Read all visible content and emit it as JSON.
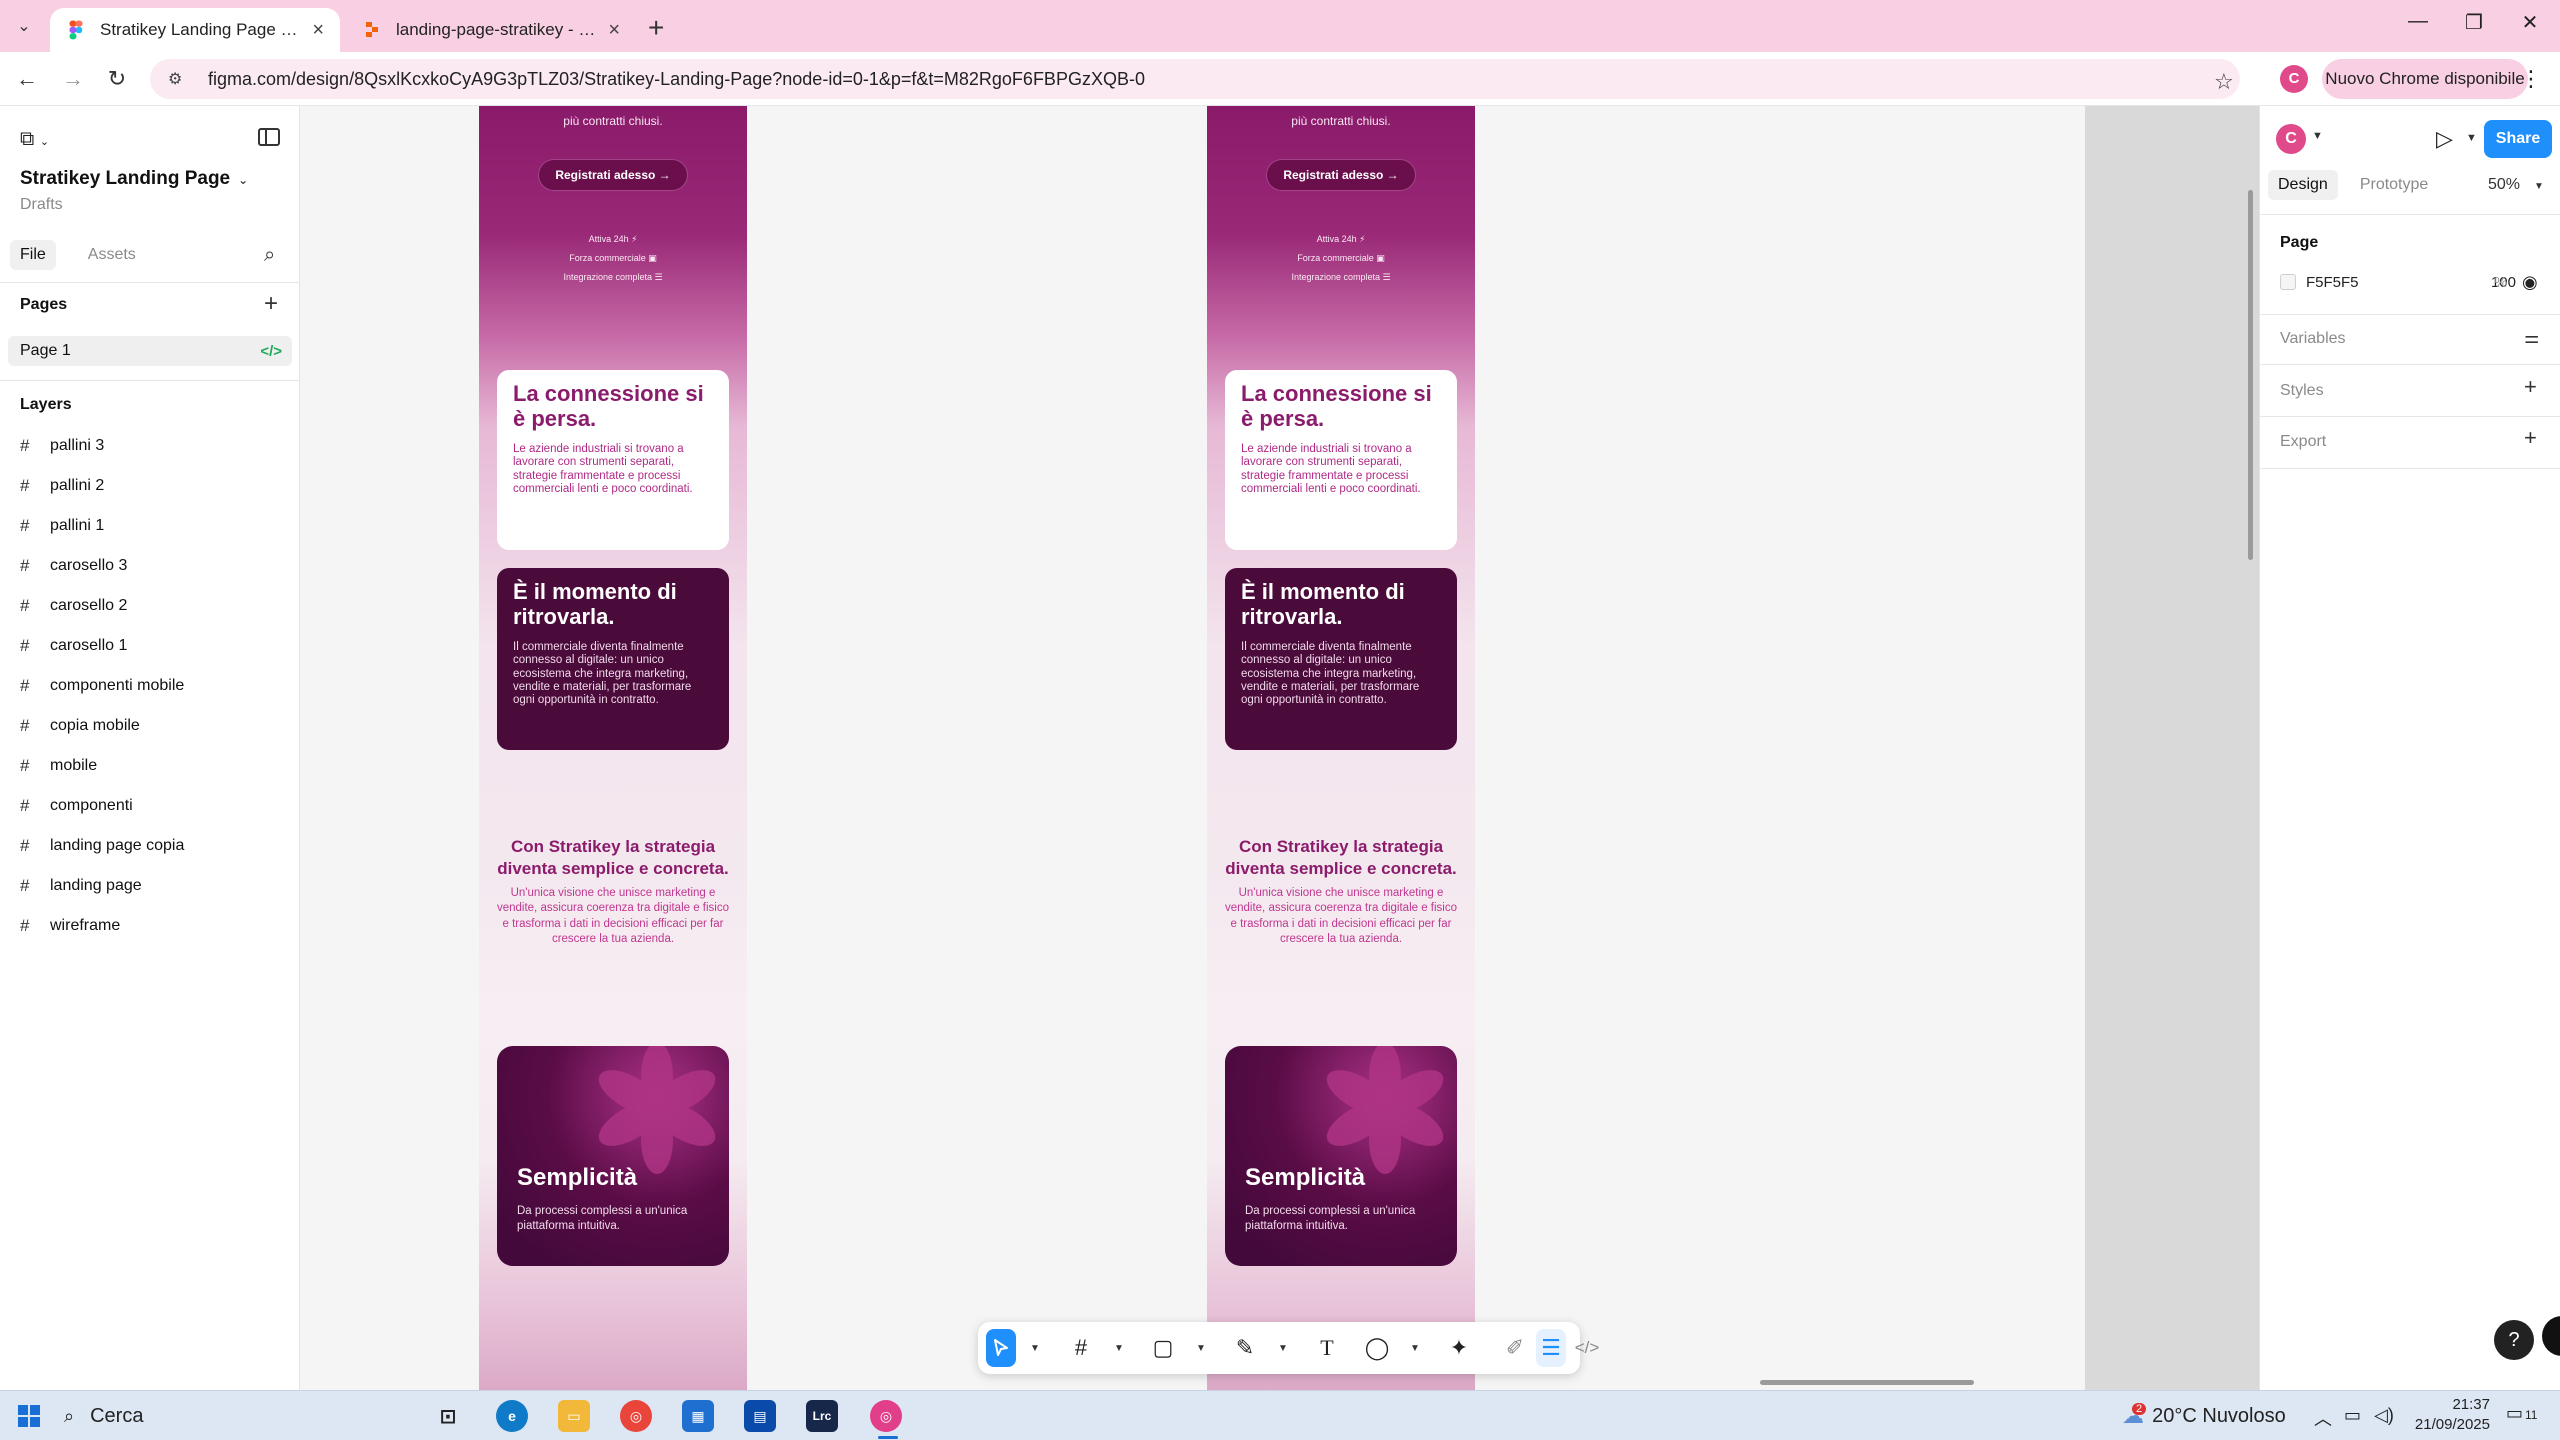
{
  "browser": {
    "tabs": [
      {
        "title": "Stratikey Landing Page – Figma",
        "active": true
      },
      {
        "title": "landing-page-stratikey - Replit",
        "active": false
      }
    ],
    "url": "figma.com/design/8QsxlKcxkoCyA9G3pTLZ03/Stratikey-Landing-Page?node-id=0-1&p=f&t=M82RgoF6FBPGzXQB-0",
    "profile_initial": "C",
    "update_label": "Nuovo Chrome disponibile"
  },
  "left_panel": {
    "file_name": "Stratikey Landing Page",
    "location": "Drafts",
    "tabs": [
      "File",
      "Assets"
    ],
    "pages_heading": "Pages",
    "pages": [
      "Page 1"
    ],
    "layers_heading": "Layers",
    "layers": [
      "pallini 3",
      "pallini 2",
      "pallini 1",
      "carosello 3",
      "carosello 2",
      "carosello 1",
      "componenti mobile",
      "copia mobile",
      "mobile",
      "componenti",
      "landing page copia",
      "landing page",
      "wireframe"
    ]
  },
  "frame": {
    "top_line": "più contratti chiusi.",
    "cta": "Registrati adesso →",
    "features": [
      "Attiva 24h ⚡",
      "Forza commerciale ▣",
      "Integrazione completa ☰"
    ],
    "card1_title": "La connessione si è persa.",
    "card1_body": "Le aziende industriali si trovano a lavorare con strumenti separati, strategie frammentate e processi commerciali lenti e poco coordinati.",
    "card2_title": "È il momento di ritrovarla.",
    "card2_body": "Il commerciale diventa finalmente connesso al digitale: un unico ecosistema che integra marketing, vendite e materiali, per trasformare ogni opportunità in contratto.",
    "strategy_title": "Con Stratikey la strategia diventa semplice e concreta.",
    "strategy_body": "Un'unica visione che unisce marketing e vendite, assicura coerenza tra digitale e fisico e trasforma i dati in decisioni efficaci per far crescere la tua azienda.",
    "card3_title": "Semplicità",
    "card3_body": "Da processi complessi a un'unica piattaforma intuitiva."
  },
  "right_panel": {
    "avatar_initial": "C",
    "share_label": "Share",
    "tabs": [
      "Design",
      "Prototype"
    ],
    "zoom": "50%",
    "page_heading": "Page",
    "page_fill_hex": "F5F5F5",
    "page_fill_opacity": "100",
    "page_fill_pct": "%",
    "variables_label": "Variables",
    "styles_label": "Styles",
    "export_label": "Export"
  },
  "toolbar_icons": [
    "move-tool",
    "frame-tool",
    "shape-tool",
    "pen-tool",
    "text-tool",
    "comment-tool",
    "actions-tool",
    "draw-mode",
    "design-mode",
    "dev-mode"
  ],
  "taskbar": {
    "search_label": "Cerca",
    "weather": "20°C Nuvoloso",
    "weather_badge": "2",
    "time": "21:37",
    "date": "21/09/2025",
    "notifications": "11"
  },
  "colors": {
    "figma_blue": "#1e8ffb",
    "chrome_tab_strip": "#f8cfe3",
    "brand_plum": "#8b1c6c",
    "brand_dark": "#4a0a3a"
  }
}
